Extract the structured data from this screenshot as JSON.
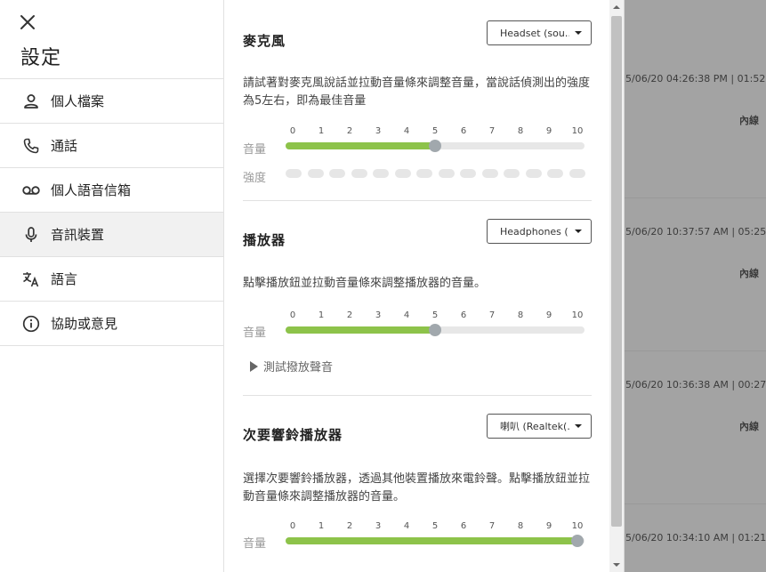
{
  "background": {
    "entries": [
      {
        "time": "5/06/20 04:26:38 PM | 01:52",
        "direction": "內線"
      },
      {
        "time": "5/06/20 10:37:57 AM | 05:25",
        "direction": "內線"
      },
      {
        "time": "5/06/20 10:36:38 AM | 00:27",
        "direction": "內線"
      },
      {
        "time": "5/06/20 10:34:10 AM | 01:21",
        "direction": ""
      }
    ]
  },
  "sidebar": {
    "title": "設定",
    "items": [
      {
        "label": "個人檔案",
        "icon": "person-icon"
      },
      {
        "label": "通話",
        "icon": "phone-icon"
      },
      {
        "label": "個人語音信箱",
        "icon": "voicemail-icon"
      },
      {
        "label": "音訊裝置",
        "icon": "microphone-icon",
        "active": true
      },
      {
        "label": "語言",
        "icon": "translate-icon"
      },
      {
        "label": "協助或意見",
        "icon": "info-icon"
      }
    ]
  },
  "microphone": {
    "title": "麥克風",
    "device": "Headset (sou…",
    "description": "請試著對麥克風說話並拉動音量條來調整音量，當說話偵測出的強度為5左右，即為最佳音量",
    "volume_label": "音量",
    "strength_label": "強度",
    "volume_value": 5
  },
  "player": {
    "title": "播放器",
    "device": "Headphones (…",
    "description": "點擊播放鈕並拉動音量條來調整播放器的音量。",
    "volume_label": "音量",
    "volume_value": 5,
    "test_label": "測試撥放聲音"
  },
  "secondary_ringer": {
    "title": "次要響鈴播放器",
    "device": "喇叭 (Realtek(…",
    "description": "選擇次要響鈴播放器，透過其他裝置播放來電鈴聲。點擊播放鈕並拉動音量條來調整播放器的音量。",
    "volume_label": "音量",
    "volume_value": 10
  },
  "scale": {
    "min": 0,
    "max": 10,
    "ticks": [
      "0",
      "1",
      "2",
      "3",
      "4",
      "5",
      "6",
      "7",
      "8",
      "9",
      "10"
    ]
  },
  "colors": {
    "fill": "#8dc34a",
    "track": "#e7e7e7",
    "thumb": "#a1a8ad"
  }
}
